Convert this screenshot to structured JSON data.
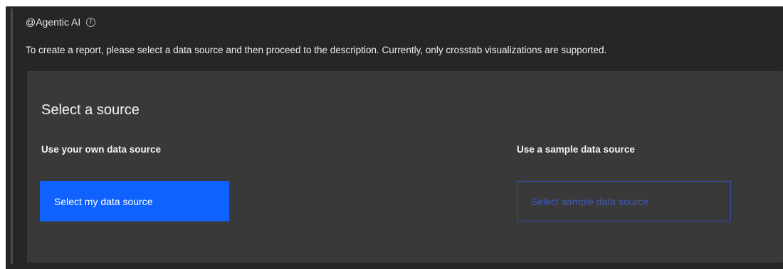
{
  "header": {
    "title": "@Agentic AI",
    "info_icon": "info-icon"
  },
  "instructions": "To create a report, please select a data source and then proceed to the description. Currently, only crosstab visualizations are supported.",
  "source_card": {
    "title": "Select a source",
    "own": {
      "label": "Use your own data source",
      "button": "Select my data source"
    },
    "sample": {
      "label": "Use a sample data source",
      "button": "Select sample data source"
    }
  },
  "colors": {
    "background": "#262626",
    "card": "#393939",
    "primary_button": "#0f62fe",
    "secondary_button_border": "#3252b4"
  }
}
